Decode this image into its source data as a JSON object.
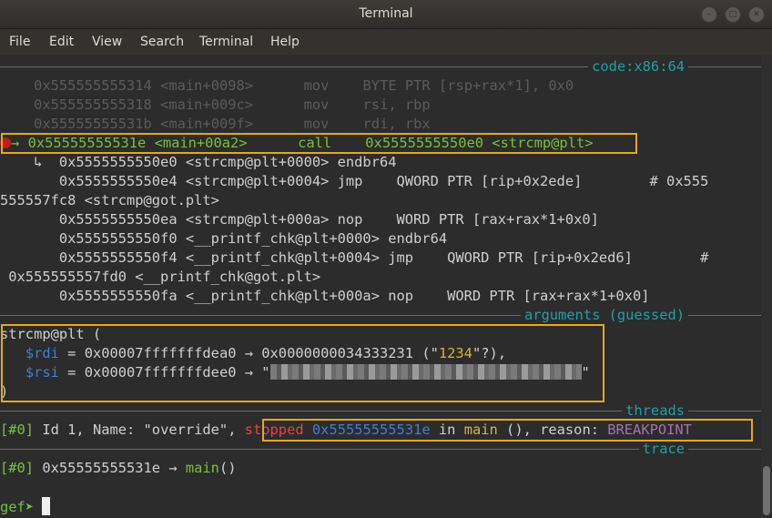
{
  "window": {
    "title": "Terminal"
  },
  "menu": [
    "File",
    "Edit",
    "View",
    "Search",
    "Terminal",
    "Help"
  ],
  "sections": {
    "code": "code:x86:64",
    "arguments": "arguments (guessed)",
    "threads": "threads",
    "trace": "trace"
  },
  "code_lines": [
    {
      "addr": "0x555555555314",
      "sym": "<main+0098>",
      "mnem": "mov",
      "ops": "BYTE PTR [rsp+rax*1], 0x0"
    },
    {
      "addr": "0x555555555318",
      "sym": "<main+009c>",
      "mnem": "mov",
      "ops": "rsi, rbp"
    },
    {
      "addr": "0x55555555531b",
      "sym": "<main+009f>",
      "mnem": "mov",
      "ops": "rdi, rbx"
    }
  ],
  "current": {
    "arrow": "→",
    "addr": "0x55555555531e",
    "sym": "<main+00a2>",
    "mnem": "call",
    "target": "0x5555555550e0",
    "target_sym": "<strcmp@plt>"
  },
  "branch_lines": [
    "    ↳  0x5555555550e0 <strcmp@plt+0000> endbr64",
    "       0x5555555550e4 <strcmp@plt+0004> jmp    QWORD PTR [rip+0x2ede]        # 0x555",
    "555557fc8 <strcmp@got.plt>",
    "       0x5555555550ea <strcmp@plt+000a> nop    WORD PTR [rax+rax*1+0x0]",
    "       0x5555555550f0 <__printf_chk@plt+0000> endbr64",
    "       0x5555555550f4 <__printf_chk@plt+0004> jmp    QWORD PTR [rip+0x2ed6]        #",
    " 0x555555557fd0 <__printf_chk@got.plt>",
    "       0x5555555550fa <__printf_chk@plt+000a> nop    WORD PTR [rax+rax*1+0x0]"
  ],
  "args": {
    "header": "strcmp@plt (",
    "rdi": {
      "reg": "$rdi",
      "val": " = 0x00007fffffffdea0 → 0x0000000034333231 (\"",
      "str": "1234",
      "tail": "\"?),"
    },
    "rsi": {
      "reg": "$rsi",
      "val": " = 0x00007fffffffdee0 → \"",
      "tail": "\""
    },
    "footer": ")"
  },
  "thread": {
    "id": "[#0]",
    "info": " Id 1, Name: \"override\", ",
    "state": "stopped",
    "addr": "0x55555555531e",
    "in": " in ",
    "func": "main",
    "reason_label": " (), reason: ",
    "reason": "BREAKPOINT"
  },
  "trace": {
    "id": "[#0]",
    "text": " 0x55555555531e → ",
    "func": "main",
    "tail": "()"
  },
  "prompt": "gef➤ "
}
